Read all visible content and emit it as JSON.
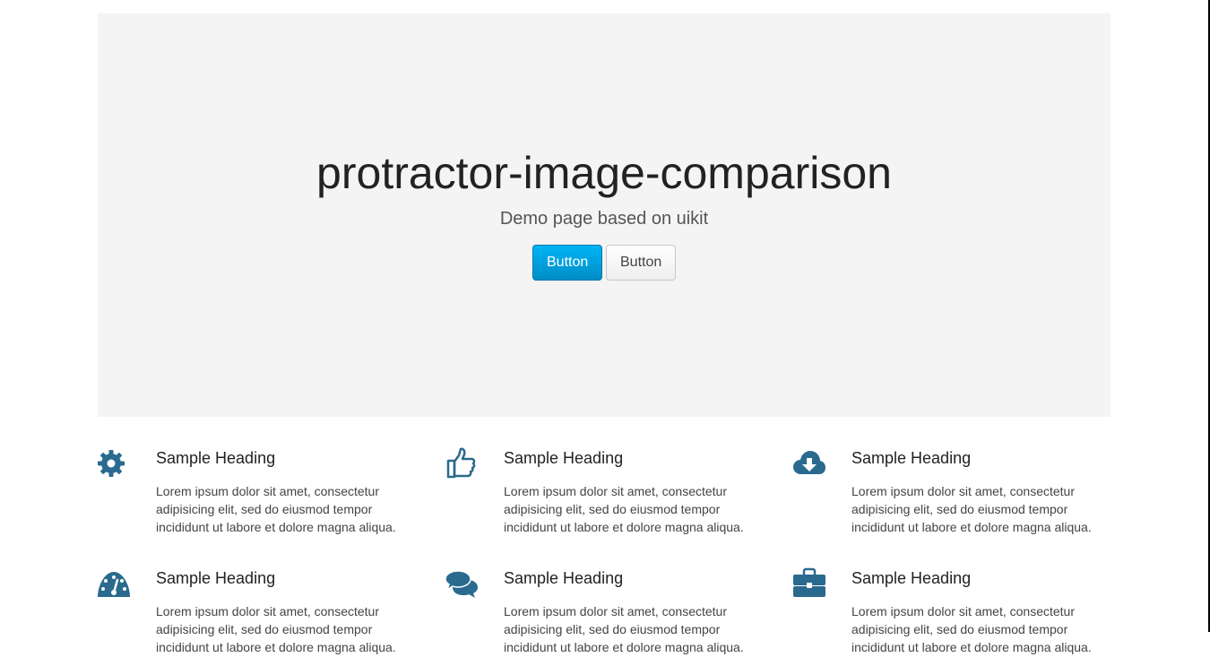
{
  "hero": {
    "title": "protractor-image-comparison",
    "lead": "Demo page based on uikit",
    "primary_button": "Button",
    "secondary_button": "Button"
  },
  "colors": {
    "hero_background": "#f4f4f4",
    "primary_button": "#009dd8",
    "icon": "#2a6a8e"
  },
  "features": [
    {
      "icon": "gear-icon",
      "heading": "Sample Heading",
      "text": "Lorem ipsum dolor sit amet, consectetur adipisicing elit, sed do eiusmod tempor incididunt ut labore et dolore magna aliqua."
    },
    {
      "icon": "thumbs-up-icon",
      "heading": "Sample Heading",
      "text": "Lorem ipsum dolor sit amet, consectetur adipisicing elit, sed do eiusmod tempor incididunt ut labore et dolore magna aliqua."
    },
    {
      "icon": "cloud-download-icon",
      "heading": "Sample Heading",
      "text": "Lorem ipsum dolor sit amet, consectetur adipisicing elit, sed do eiusmod tempor incididunt ut labore et dolore magna aliqua."
    },
    {
      "icon": "dashboard-icon",
      "heading": "Sample Heading",
      "text": "Lorem ipsum dolor sit amet, consectetur adipisicing elit, sed do eiusmod tempor incididunt ut labore et dolore magna aliqua."
    },
    {
      "icon": "comments-icon",
      "heading": "Sample Heading",
      "text": "Lorem ipsum dolor sit amet, consectetur adipisicing elit, sed do eiusmod tempor incididunt ut labore et dolore magna aliqua."
    },
    {
      "icon": "briefcase-icon",
      "heading": "Sample Heading",
      "text": "Lorem ipsum dolor sit amet, consectetur adipisicing elit, sed do eiusmod tempor incididunt ut labore et dolore magna aliqua."
    }
  ]
}
